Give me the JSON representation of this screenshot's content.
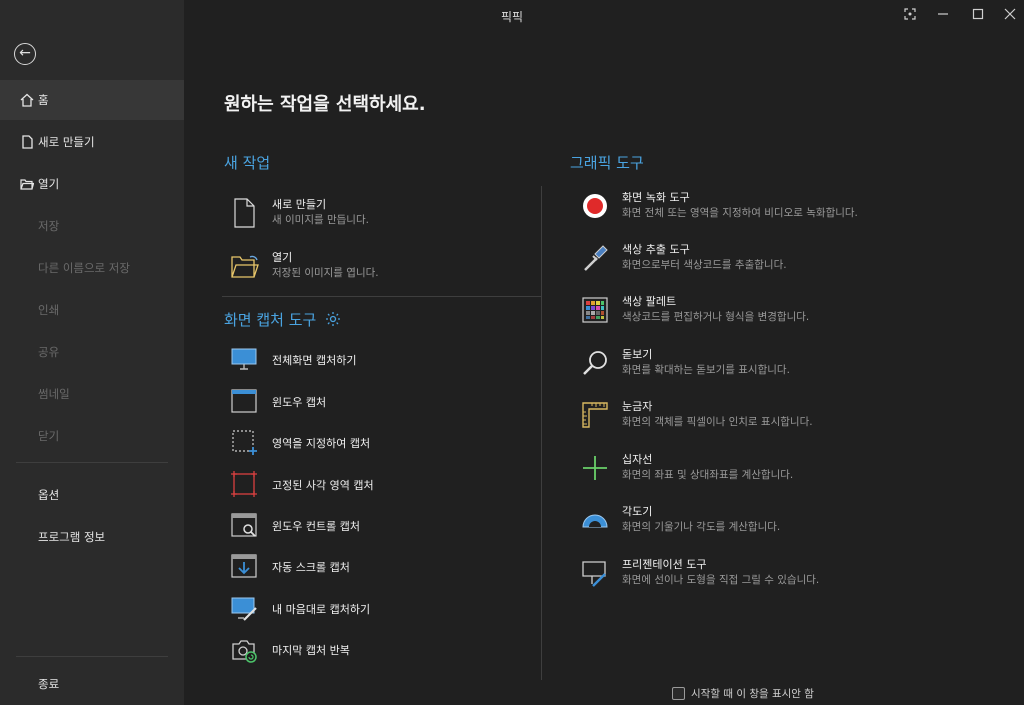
{
  "window": {
    "title": "픽픽"
  },
  "sidebar": {
    "items": [
      {
        "label": "홈"
      },
      {
        "label": "새로 만들기"
      },
      {
        "label": "열기"
      },
      {
        "label": "저장"
      },
      {
        "label": "다른 이름으로 저장"
      },
      {
        "label": "인쇄"
      },
      {
        "label": "공유"
      },
      {
        "label": "썸네일"
      },
      {
        "label": "닫기"
      },
      {
        "label": "옵션"
      },
      {
        "label": "프로그램 정보"
      },
      {
        "label": "종료"
      }
    ]
  },
  "main": {
    "title": "원하는 작업을 선택하세요.",
    "new_task": {
      "heading": "새 작업",
      "items": [
        {
          "title": "새로 만들기",
          "desc": "새 이미지를 만듭니다."
        },
        {
          "title": "열기",
          "desc": "저장된 이미지를 엽니다."
        }
      ]
    },
    "capture": {
      "heading": "화면 캡처 도구",
      "items": [
        {
          "title": "전체화면 캡처하기"
        },
        {
          "title": "윈도우 캡처"
        },
        {
          "title": "영역을 지정하여 캡처"
        },
        {
          "title": "고정된 사각 영역 캡처"
        },
        {
          "title": "윈도우 컨트롤 캡처"
        },
        {
          "title": "자동 스크롤 캡처"
        },
        {
          "title": "내 마음대로 캡처하기"
        },
        {
          "title": "마지막 캡처 반복"
        }
      ]
    },
    "graphic": {
      "heading": "그래픽 도구",
      "items": [
        {
          "title": "화면 녹화 도구",
          "desc": "화면 전체 또는 영역을 지정하여 비디오로 녹화합니다."
        },
        {
          "title": "색상 추출 도구",
          "desc": "화면으로부터 색상코드를 추출합니다."
        },
        {
          "title": "색상 팔레트",
          "desc": "색상코드를 편집하거나 형식을 변경합니다."
        },
        {
          "title": "돋보기",
          "desc": "화면를 확대하는 돋보기를 표시합니다."
        },
        {
          "title": "눈금자",
          "desc": "화면의 객체를 픽셀이나 인치로 표시합니다."
        },
        {
          "title": "십자선",
          "desc": "화면의 좌표 및 상대좌표를 계산합니다."
        },
        {
          "title": "각도기",
          "desc": "화면의 기울기나 각도를 계산합니다."
        },
        {
          "title": "프리젠테이션 도구",
          "desc": "화면에 선이나 도형을 직접 그릴 수 있습니다."
        }
      ]
    }
  },
  "footer": {
    "dont_show_label": "시작할 때 이 창을 표시안 함",
    "dont_show_checked": false
  },
  "colors": {
    "accent": "#4aa3e0",
    "sidebar_bg": "#2b2b2b",
    "main_bg": "#202020",
    "record_red": "#e02a2a"
  }
}
